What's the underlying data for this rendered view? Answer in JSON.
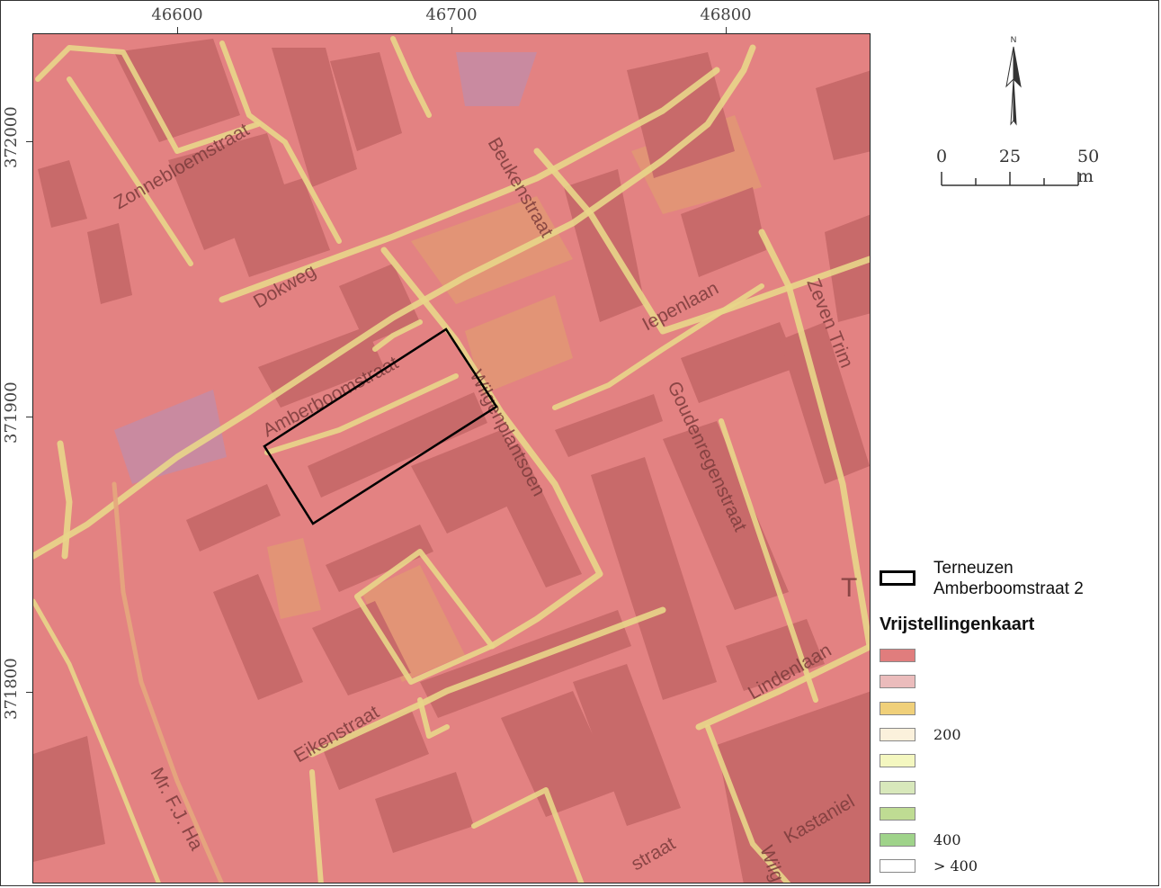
{
  "map": {
    "x_ticks": [
      "46600",
      "46700",
      "46800"
    ],
    "y_ticks": [
      "372000",
      "371900",
      "371800"
    ],
    "streets": [
      "Zonnebloemstraat",
      "Dokweg",
      "Beukenstraat",
      "Iepenlaan",
      "Zeven Trim",
      "Amberboomstraat",
      "Wilgenplantsoen",
      "Goudenregenstraat",
      "Lindenlaan",
      "Eikenstraat",
      "Mr. F.J. Ha",
      "Kastaniel",
      "Wilg",
      "straat",
      "T"
    ],
    "study_site_label": "Terneuzen Amberboomstraat 2"
  },
  "north_arrow": {
    "label": "N"
  },
  "scale_bar": {
    "labels": [
      "0",
      "25",
      "50 m"
    ]
  },
  "legend": {
    "site_line1": "Terneuzen",
    "site_line2": "Amberboomstraat 2",
    "title": "Vrijstellingenkaart",
    "classes": [
      {
        "color": "#e07d7d",
        "label": ""
      },
      {
        "color": "#ebbcbc",
        "label": ""
      },
      {
        "color": "#f0d07a",
        "label": ""
      },
      {
        "color": "#fbf1dc",
        "label": "200"
      },
      {
        "color": "#f4f7c0",
        "label": ""
      },
      {
        "color": "#d8e8bb",
        "label": ""
      },
      {
        "color": "#bfdc93",
        "label": ""
      },
      {
        "color": "#9fd38a",
        "label": "400"
      },
      {
        "color": "#ffffff",
        "label": "> 400"
      }
    ]
  },
  "colors": {
    "overlay": "#e07d7d",
    "road": "#e8d68a",
    "site_outline": "#000000"
  }
}
